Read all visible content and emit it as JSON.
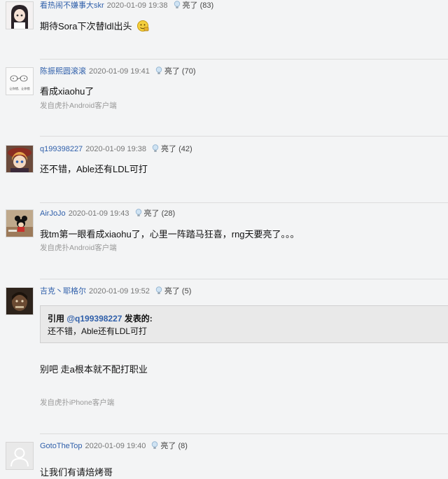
{
  "light_label": "亮了",
  "posts": [
    {
      "user": "看热闹不嫌事大skr",
      "time": "2020-01-09 19:38",
      "light_count": "(83)",
      "content": "期待Sora下次替ldl出头",
      "source": "",
      "avatar": "anime-girl-avatar"
    },
    {
      "user": "陈振熙圆滚滚",
      "time": "2020-01-09 19:41",
      "light_count": "(70)",
      "content": "看成xiaohu了",
      "source": "发自虎扑Android客户端",
      "avatar": "cartoon-sticker-avatar",
      "avatar_caption": "让你错、让你错"
    },
    {
      "user": "q199398227",
      "time": "2020-01-09 19:38",
      "light_count": "(42)",
      "content": "还不错，Able还有LDL可打",
      "source": "",
      "avatar": "anime-hat-avatar"
    },
    {
      "user": "AirJoJo",
      "time": "2020-01-09 19:43",
      "light_count": "(28)",
      "content": "我tm第一眼看成xiaohu了，心里一阵踏马狂喜，rng天要亮了。。。",
      "source": "发自虎扑Android客户端",
      "avatar": "mickey-avatar"
    },
    {
      "user": "吉克丶耶格尔",
      "time": "2020-01-09 19:52",
      "light_count": "(5)",
      "content": "别吧 走a根本就不配打职业",
      "source": "发自虎扑iPhone客户端",
      "avatar": "titan-avatar",
      "quote": {
        "prefix": "引用 ",
        "user": "@q199398227",
        "suffix": " 发表的:",
        "text": "还不错，Able还有LDL可打"
      }
    },
    {
      "user": "GotoTheTop",
      "time": "2020-01-09 19:40",
      "light_count": "(8)",
      "content": "让我们有请焙烤哥",
      "source": "",
      "avatar": "default-user-avatar"
    }
  ]
}
